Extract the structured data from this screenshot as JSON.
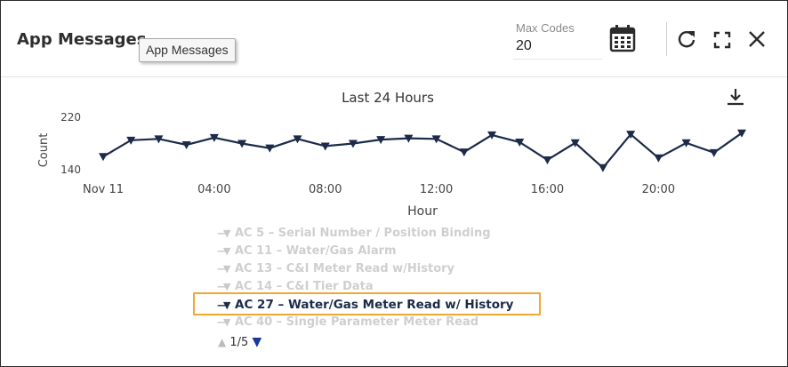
{
  "window": {
    "title": "App Messages",
    "tooltip": "App Messages"
  },
  "controls": {
    "max_codes_label": "Max Codes",
    "max_codes_value": "20",
    "icons": [
      "calendar-icon",
      "refresh-icon",
      "expand-icon",
      "close-icon",
      "download-icon"
    ]
  },
  "colors": {
    "series": "#1c2b4a",
    "highlight": "#f0a830",
    "inactive_legend": "#cfcfcf",
    "pager_down": "#163a9c"
  },
  "chart_data": {
    "type": "line",
    "title": "Last 24 Hours",
    "xlabel": "Hour",
    "ylabel": "Count",
    "ylim": [
      140,
      220
    ],
    "y_ticks": [
      "220",
      "140"
    ],
    "x_tick_labels": [
      "Nov 11",
      "04:00",
      "08:00",
      "12:00",
      "16:00",
      "20:00"
    ],
    "x_tick_hours": [
      0,
      4,
      8,
      12,
      16,
      20
    ],
    "x_range": [
      0,
      23
    ],
    "grid": false,
    "series": [
      {
        "name": "AC 27 – Water/Gas Meter Read w/ History",
        "marker": "triangle-down",
        "x": [
          0,
          1,
          2,
          3,
          4,
          5,
          6,
          7,
          8,
          9,
          10,
          11,
          12,
          13,
          14,
          15,
          16,
          17,
          18,
          19,
          20,
          21,
          22,
          23
        ],
        "values": [
          160,
          185,
          187,
          178,
          189,
          180,
          173,
          187,
          176,
          180,
          186,
          188,
          187,
          167,
          193,
          182,
          155,
          181,
          143,
          194,
          158,
          181,
          166,
          196
        ]
      }
    ]
  },
  "legend": {
    "items": [
      {
        "label": "AC 5 – Serial Number / Position Binding",
        "active": false
      },
      {
        "label": "AC 11 – Water/Gas Alarm",
        "active": false
      },
      {
        "label": "AC 13 – C&I Meter Read w/History",
        "active": false
      },
      {
        "label": "AC 14 – C&I Tier Data",
        "active": false
      },
      {
        "label": "AC 27 – Water/Gas Meter Read w/ History",
        "active": true
      },
      {
        "label": "AC 40 – Single Parameter Meter Read",
        "active": false
      }
    ],
    "pager": "1/5"
  }
}
